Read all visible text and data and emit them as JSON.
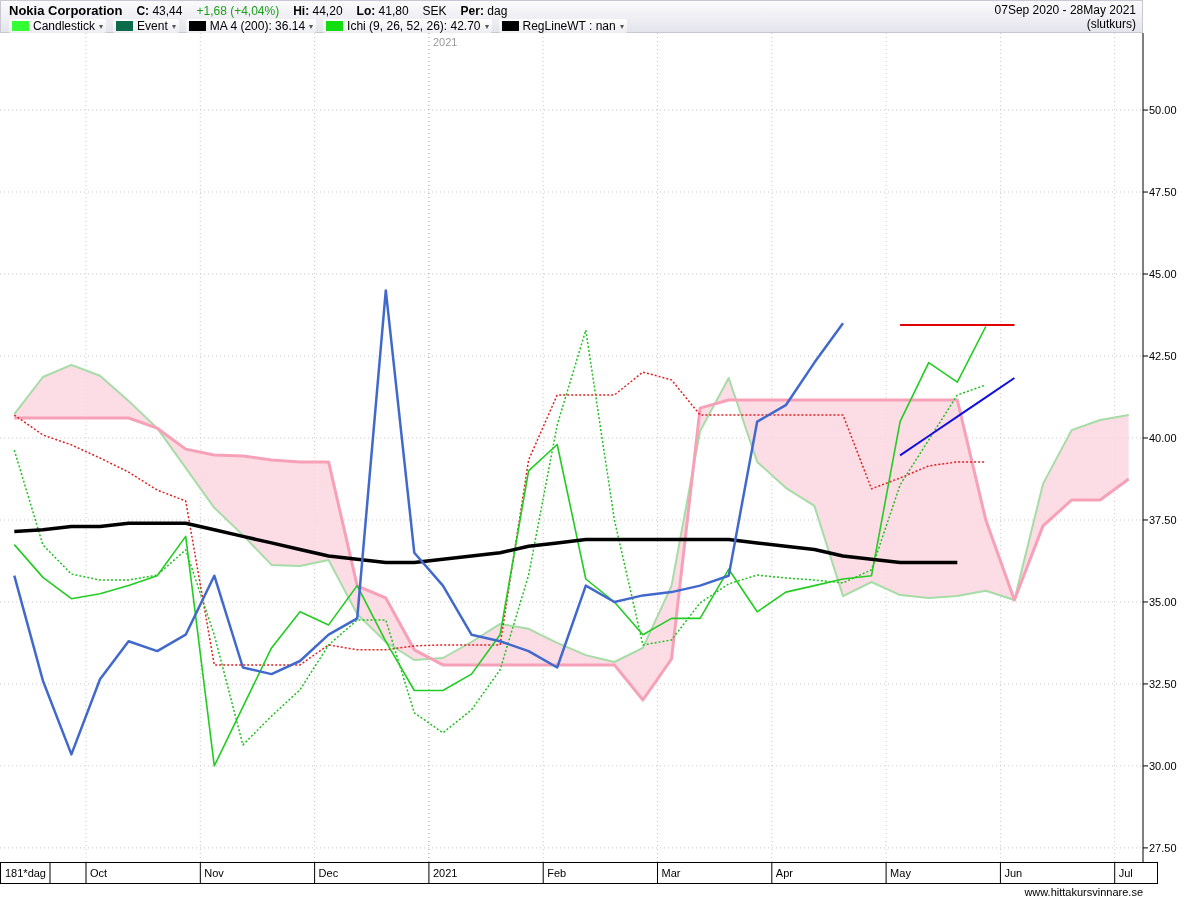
{
  "header": {
    "title": "Nokia Corporation",
    "close": "**C:** 43,44",
    "change": "+1,68 (+4,04%)",
    "high": "**Hi:** 44,20",
    "low": "**Lo:** 41,80",
    "currency": "SEK",
    "period": "**Per:** dag",
    "range": "07Sep 2020 - 28May 2021",
    "range_note": "(slutkurs)"
  },
  "legend": [
    {
      "kind": "series",
      "color": "#33ff33",
      "caret": "▾"
    },
    {
      "kind": "plain",
      "label": "Event",
      "color": "#0b6b4a",
      "caret": "▾"
    },
    {
      "kind": "series",
      "color": "#000000",
      "caret": "▾"
    },
    {
      "kind": "series",
      "color": "#11dd11",
      "caret": "▾"
    },
    {
      "kind": "plain",
      "label": "RegLineWT : nan",
      "color": "#000000",
      "caret": "▾"
    }
  ],
  "chart": {
    "year_marker": "2021",
    "day_count": "181*dag",
    "footer": "www.hittakursvinnare.se",
    "chart_data": {
      "type": "line",
      "categories": [
        null,
        null,
        null,
        "Oct",
        null,
        null,
        null,
        "Nov",
        null,
        null,
        null,
        "Dec",
        null,
        null,
        null,
        "2021",
        null,
        null,
        null,
        "Feb",
        null,
        null,
        null,
        "Mar",
        null,
        null,
        null,
        "Apr",
        null,
        null,
        null,
        "May",
        null,
        null,
        null,
        "Jun",
        null,
        null,
        null,
        "Jul"
      ],
      "ylim": [
        27.07,
        52.35
      ],
      "grid": true,
      "yticks": [
        {
          "value": 27.5,
          "label": "27.50"
        },
        {
          "value": 30,
          "label": "30.00"
        },
        {
          "value": 32.5,
          "label": "32.50"
        },
        {
          "value": 35,
          "label": "35.00"
        },
        {
          "value": 37.5,
          "label": "37.50"
        },
        {
          "value": 40,
          "label": "40.00"
        },
        {
          "value": 42.5,
          "label": "42.50"
        },
        {
          "value": 45,
          "label": "45.00"
        },
        {
          "value": 47.5,
          "label": "47.50"
        },
        {
          "value": 50,
          "label": "50.00"
        }
      ],
      "series": [
        {
          "name": "Candlestick",
          "color": "#22cc22",
          "values": [
            36.75,
            35.75,
            35.1,
            35.25,
            35.5,
            35.8,
            37.0,
            30.0,
            31.8,
            33.6,
            34.7,
            34.3,
            35.5,
            33.8,
            32.3,
            32.3,
            32.8,
            34.0,
            39.0,
            39.8,
            35.7,
            35.0,
            34.0,
            34.5,
            34.5,
            36.0,
            34.7,
            35.3,
            35.5,
            35.7,
            35.8,
            40.5,
            42.3,
            41.7,
            43.4,
            null,
            null,
            null,
            null,
            null
          ]
        },
        {
          "name": "MA 4 (200): 36.14",
          "color": "#000000",
          "values": [
            37.15,
            37.2,
            37.3,
            37.3,
            37.4,
            37.4,
            37.4,
            37.2,
            37.0,
            36.8,
            36.6,
            36.4,
            36.3,
            36.2,
            36.2,
            36.3,
            36.4,
            36.5,
            36.7,
            36.8,
            36.9,
            36.9,
            36.9,
            36.9,
            36.9,
            36.9,
            36.8,
            36.7,
            36.6,
            36.4,
            36.3,
            36.2,
            36.2,
            36.2,
            null,
            null,
            null,
            null,
            null,
            null
          ]
        },
        {
          "name": "Ichi (9, 26, 52, 26): 42.70",
          "color": "#4169cc",
          "values": [
            35.8,
            32.6,
            30.35,
            32.64,
            33.8,
            33.5,
            34.0,
            35.8,
            33.0,
            32.8,
            33.2,
            34.0,
            34.5,
            44.5,
            36.5,
            35.5,
            34.0,
            33.8,
            33.5,
            33.0,
            35.5,
            35.0,
            35.2,
            35.3,
            35.5,
            35.8,
            40.5,
            41.0,
            42.3,
            43.5,
            null,
            null,
            null,
            null,
            null,
            null,
            null,
            null,
            null,
            null
          ]
        },
        {
          "color": "#a6dca6",
          "values": [
            40.73,
            41.86,
            42.23,
            41.9,
            41.13,
            40.3,
            39.09,
            37.87,
            37.04,
            36.13,
            36.1,
            36.28,
            34.63,
            33.78,
            33.23,
            33.29,
            33.78,
            34.33,
            34.18,
            33.75,
            33.38,
            33.17,
            33.6,
            35.49,
            40.21,
            41.83,
            39.27,
            38.48,
            37.93,
            35.18,
            35.61,
            35.21,
            35.12,
            35.18,
            35.34,
            35.06,
            38.6,
            40.24,
            40.55,
            40.7
          ]
        },
        {
          "color": "#f7a1b8",
          "values": [
            40.61,
            40.61,
            40.61,
            40.61,
            40.61,
            40.3,
            39.66,
            39.48,
            39.45,
            39.33,
            39.27,
            39.27,
            35.49,
            35.12,
            33.54,
            33.08,
            33.08,
            33.08,
            33.08,
            33.08,
            33.08,
            33.08,
            32.01,
            33.26,
            40.91,
            41.16,
            41.16,
            41.16,
            41.16,
            41.16,
            41.16,
            41.16,
            41.16,
            41.16,
            37.5,
            35.06,
            37.32,
            38.11,
            38.11,
            38.75
          ]
        },
        {
          "color": "#e02020",
          "line_style": "dotted",
          "values": [
            40.7,
            40.09,
            39.79,
            39.39,
            38.96,
            38.41,
            38.08,
            33.08,
            33.08,
            33.08,
            33.08,
            33.69,
            33.54,
            33.54,
            33.66,
            33.69,
            33.69,
            33.69,
            39.33,
            41.31,
            41.31,
            41.31,
            42.01,
            41.77,
            40.7,
            40.7,
            40.7,
            40.7,
            40.7,
            40.7,
            38.45,
            38.78,
            39.15,
            39.27,
            39.27,
            null,
            null,
            null,
            null,
            null
          ]
        },
        {
          "color": "#20c020",
          "line_style": "dotted",
          "values": [
            39.63,
            36.74,
            35.85,
            35.67,
            35.67,
            35.82,
            36.59,
            33.99,
            30.64,
            31.52,
            32.32,
            33.69,
            34.45,
            34.45,
            31.62,
            31.01,
            31.71,
            32.93,
            35.82,
            40.4,
            43.29,
            37.5,
            33.69,
            33.84,
            34.97,
            35.55,
            35.82,
            35.73,
            35.67,
            35.58,
            35.98,
            38.57,
            39.94,
            41.31,
            41.62,
            null,
            null,
            null,
            null,
            null
          ]
        },
        {
          "color": "#e00000",
          "values": [
            null,
            null,
            null,
            null,
            null,
            null,
            null,
            null,
            null,
            null,
            null,
            null,
            null,
            null,
            null,
            null,
            null,
            null,
            null,
            null,
            null,
            null,
            null,
            null,
            null,
            null,
            null,
            null,
            null,
            null,
            null,
            43.45,
            43.45,
            43.45,
            43.45,
            43.45,
            null,
            null,
            null,
            null
          ]
        },
        {
          "color": "#1010dd",
          "values": [
            null,
            null,
            null,
            null,
            null,
            null,
            null,
            null,
            null,
            null,
            null,
            null,
            null,
            null,
            null,
            null,
            null,
            null,
            null,
            null,
            null,
            null,
            null,
            null,
            null,
            null,
            null,
            null,
            null,
            null,
            null,
            39.47,
            40.06,
            40.65,
            41.24,
            41.83,
            null,
            null,
            null,
            null
          ]
        }
      ]
    }
  }
}
